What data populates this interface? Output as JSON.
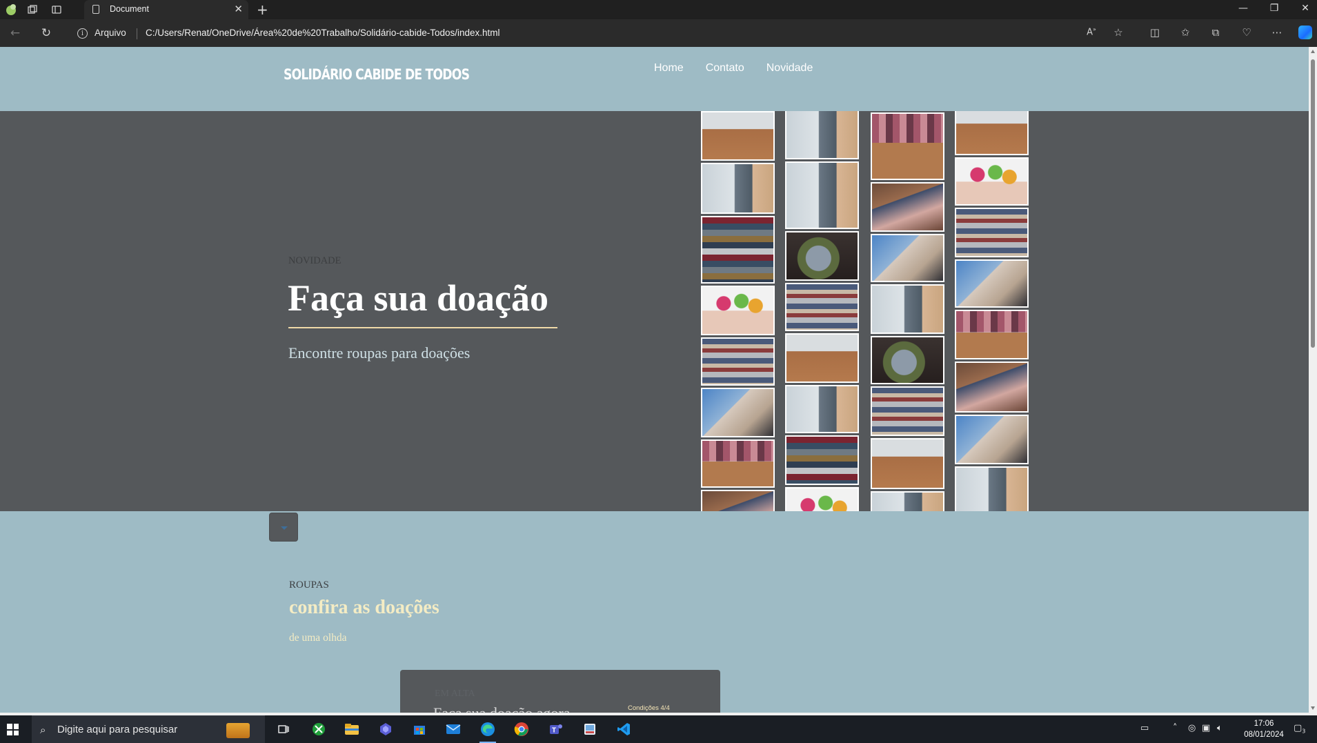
{
  "browser": {
    "tab_title": "Document",
    "address_label": "Arquivo",
    "url": "C:/Users/Renat/OneDrive/Área%20de%20Trabalho/Solidário-cabide-Todos/index.html"
  },
  "site": {
    "logo": "SOLIDÁRIO CABIDE DE TODOS",
    "nav": [
      "Home",
      "Contato",
      "Novidade"
    ]
  },
  "hero": {
    "kicker": "NOVIDADE",
    "title": "Faça sua doação",
    "subtitle": "Encontre roupas para doações"
  },
  "gallery": {
    "columns": [
      [
        "box",
        "hands",
        "pile",
        "doar",
        "stack",
        "knit",
        "shirts",
        "kid"
      ],
      [
        "hands",
        "hands",
        "dark",
        "stack",
        "box",
        "hands",
        "pile",
        "doar",
        "stack"
      ],
      [
        "shirts",
        "kid",
        "knit",
        "hands",
        "dark",
        "stack",
        "box",
        "hands"
      ],
      [
        "box",
        "doar",
        "stack",
        "knit",
        "shirts",
        "kid",
        "knit",
        "hands",
        "box"
      ]
    ]
  },
  "section": {
    "kicker": "ROUPAS",
    "title": "confira as doações",
    "subtitle": "de uma olhda"
  },
  "card": {
    "kicker": "EM ALTA",
    "title": "Faça sua doação agora",
    "tag": "Condições 4/4"
  },
  "taskbar": {
    "search_placeholder": "Digite aqui para pesquisar",
    "time": "17:06",
    "date": "08/01/2024",
    "notification_count": "3"
  },
  "colors": {
    "page_bg": "#9ebbc5",
    "hero_bg": "#55585b",
    "accent_cream": "#f4ecc4"
  }
}
